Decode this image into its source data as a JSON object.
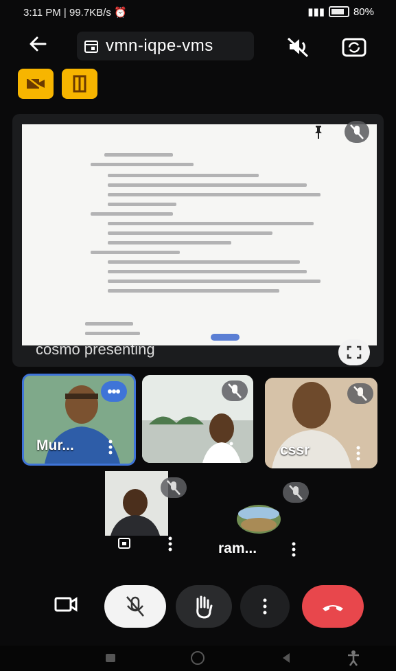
{
  "status_bar": {
    "time_speed": "3:11 PM | 99.7KB/s",
    "battery": "80%"
  },
  "top_bar": {
    "meeting_code": "vmn-iqpe-vms"
  },
  "presentation": {
    "presenter_label": "cosmo presenting"
  },
  "participants": [
    {
      "name": "Mur..."
    },
    {
      "name": ""
    },
    {
      "name": "cssr"
    }
  ],
  "ram_tile": {
    "name": "ram..."
  },
  "colors": {
    "end_call": "#e8474c",
    "accent_yellow": "#f7b500",
    "active_border": "#3f74d8"
  }
}
